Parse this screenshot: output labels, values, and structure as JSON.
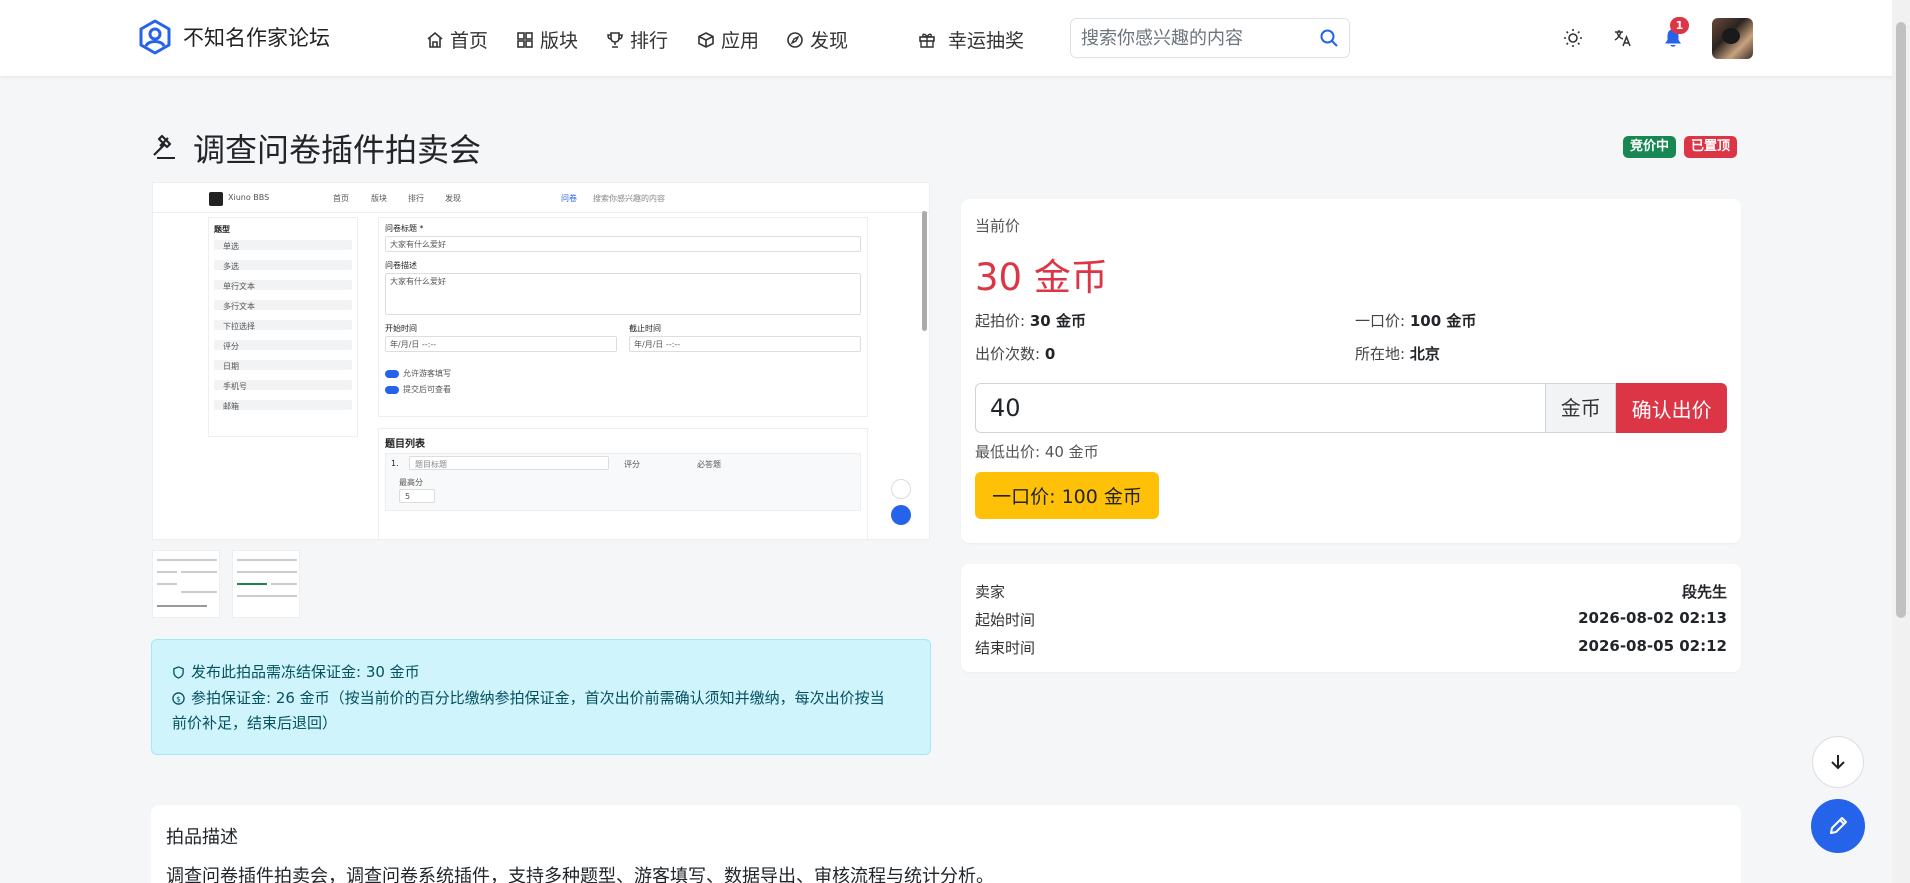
{
  "nav": {
    "brand": "不知名作家论坛",
    "items": [
      {
        "label": "首页"
      },
      {
        "label": "版块"
      },
      {
        "label": "排行"
      },
      {
        "label": "应用"
      },
      {
        "label": "发现"
      },
      {
        "label": "幸运抽奖"
      }
    ],
    "search_placeholder": "搜索你感兴趣的内容",
    "notification_count": "1",
    "colors": {
      "brand": "#2563eb"
    }
  },
  "page": {
    "title": "调查问卷插件拍卖会",
    "badges": [
      {
        "label": "竞价中",
        "color": "#198754"
      },
      {
        "label": "已置顶",
        "color": "#dc3545"
      }
    ]
  },
  "gallery": {
    "screenshot": {
      "brand": "Xiuno BBS",
      "nav": [
        "首页",
        "版块",
        "排行",
        "发现",
        "问卷"
      ],
      "search": "搜索你感兴趣的内容",
      "sidebar_title": "题型",
      "sidebar_items": [
        "单选",
        "多选",
        "单行文本",
        "多行文本",
        "下拉选择",
        "评分",
        "日期",
        "手机号",
        "邮箱"
      ],
      "form_title_label": "问卷标题 *",
      "form_title_value": "大家有什么爱好",
      "form_desc_label": "问卷描述",
      "form_desc_value": "大家有什么爱好",
      "start_label": "开始时间",
      "end_label": "截止时间",
      "datetime_placeholder": "年/月/日 --:--",
      "toggle_1": "允许游客填写",
      "toggle_2": "提交后可查看",
      "list_title": "题目列表",
      "q1_label": "1.",
      "q1_placeholder": "题目标题",
      "q1_type": "评分",
      "q1_required": "必答题",
      "q1_sub": "最高分",
      "q1_value": "5"
    }
  },
  "alert": {
    "line1": "发布此拍品需冻结保证金: 30 金币",
    "line2": "参拍保证金: 26 金币（按当前价的百分比缴纳参拍保证金，首次出价前需确认须知并缴纳，每次出价按当",
    "line3": "前价补足，结束后退回）"
  },
  "price_card": {
    "current_label": "当前价",
    "current_value": "30 金币",
    "start_label": "起拍价:",
    "start_value": "30 金币",
    "buyout_label": "一口价:",
    "buyout_value": "100 金币",
    "bids_label": "出价次数:",
    "bids_value": "0",
    "location_label": "所在地:",
    "location_value": "北京",
    "bid_input_value": "40",
    "bid_unit": "金币",
    "bid_button": "确认出价",
    "min_bid": "最低出价: 40 金币",
    "buyout_button": "一口价: 100 金币"
  },
  "seller_card": {
    "seller_label": "卖家",
    "seller_value": "段先生",
    "start_time_label": "起始时间",
    "start_time_value": "2026-08-02 02:13",
    "end_time_label": "结束时间",
    "end_time_value": "2026-08-05 02:12"
  },
  "description": {
    "title": "拍品描述",
    "text": "调查问卷插件拍卖会，调查问卷系统插件，支持多种题型、游客填写、数据导出、审核流程与统计分析。"
  }
}
